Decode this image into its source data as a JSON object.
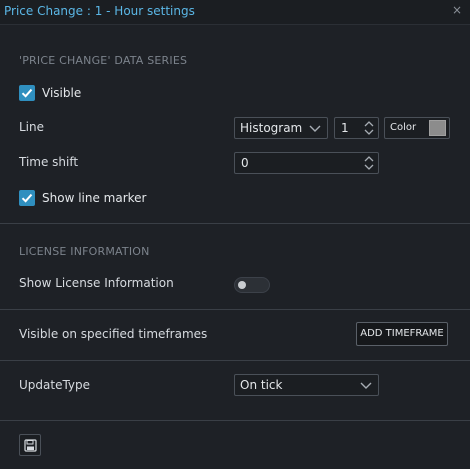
{
  "window": {
    "title": "Price Change : 1 - Hour settings",
    "close_icon": "close-icon",
    "close_glyph": "×"
  },
  "data_series": {
    "section_title": "'PRICE CHANGE' DATA SERIES",
    "visible": {
      "label": "Visible",
      "checked": true
    },
    "line": {
      "label": "Line",
      "type_value": "Histogram",
      "width_value": "1",
      "color_label": "Color",
      "color_value": "#8c8c8c"
    },
    "time_shift": {
      "label": "Time shift",
      "value": "0"
    },
    "show_line_marker": {
      "label": "Show line marker",
      "checked": true
    }
  },
  "license": {
    "section_title": "LICENSE INFORMATION",
    "show_license": {
      "label": "Show License Information",
      "enabled": false
    }
  },
  "timeframes": {
    "label": "Visible on specified timeframes",
    "add_button": "ADD TIMEFRAME"
  },
  "update": {
    "label": "UpdateType",
    "value": "On tick"
  },
  "footer": {
    "save_icon": "save-icon"
  },
  "colors": {
    "accent": "#2f8fbf",
    "title": "#5bb7e6",
    "background": "#1e2126"
  }
}
